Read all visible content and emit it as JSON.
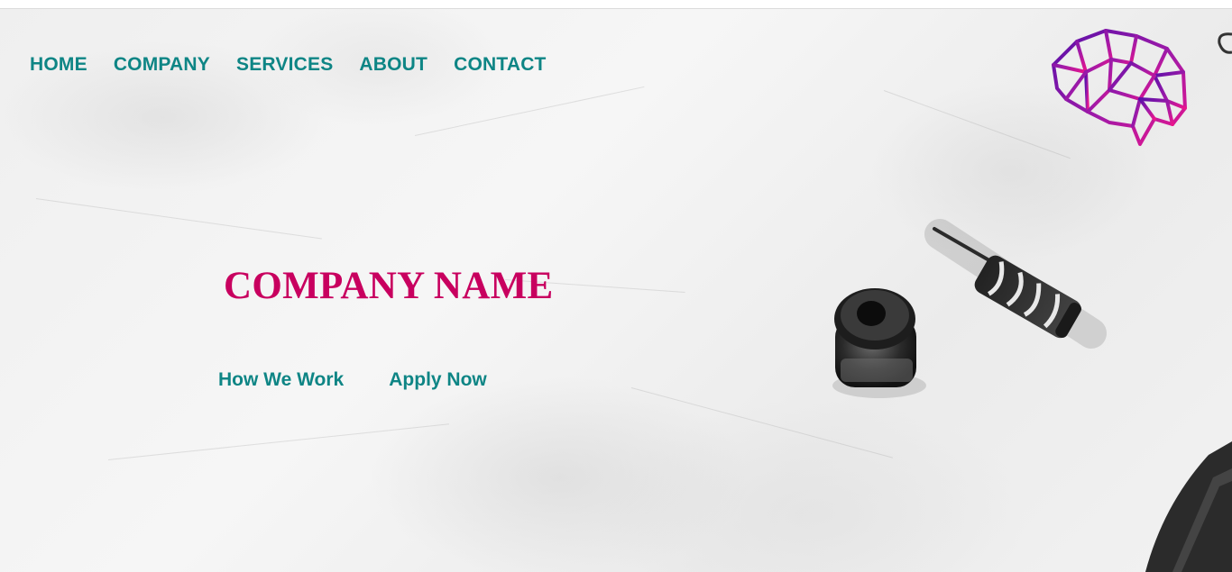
{
  "nav": {
    "items": [
      {
        "label": "HOME"
      },
      {
        "label": "COMPANY"
      },
      {
        "label": "SERVICES"
      },
      {
        "label": "ABOUT"
      },
      {
        "label": "CONTACT"
      }
    ]
  },
  "hero": {
    "title": "COMPANY NAME",
    "cta_primary": "How We Work",
    "cta_secondary": "Apply Now"
  },
  "logo": {
    "icon": "geometric-brain-icon",
    "gradient_start": "#5a10a8",
    "gradient_end": "#e8158c"
  },
  "colors": {
    "nav_text": "#0e8585",
    "title_text": "#c8005f",
    "background": "#f4f4f4"
  }
}
